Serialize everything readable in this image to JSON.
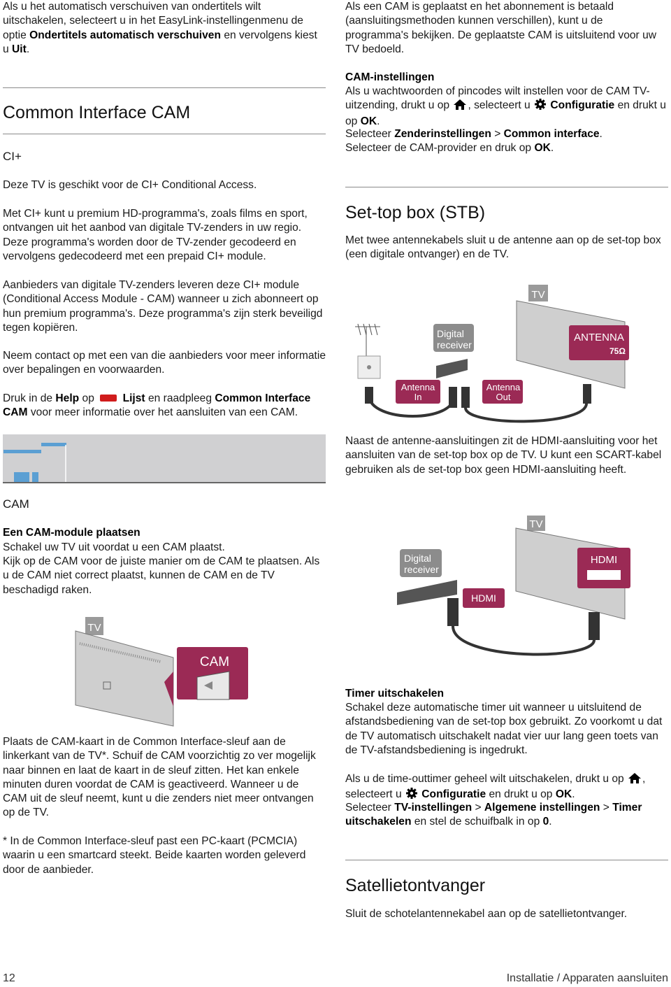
{
  "left": {
    "intro": [
      "Als u het automatisch verschuiven van ondertitels wilt uitschakelen, selecteert u in het EasyLink-instellingenmenu de optie ",
      {
        "b": "Ondertitels automatisch verschuiven"
      },
      " en vervolgens kiest u ",
      {
        "b": "Uit"
      },
      "."
    ],
    "heading": "Common Interface CAM",
    "ci_title": "CI+",
    "ci_p1": "Deze TV is geschikt voor de CI+ Conditional Access.",
    "ci_p2": "Met CI+ kunt u premium HD-programma's, zoals films en sport, ontvangen uit het aanbod van digitale TV-zenders in uw regio. Deze programma's worden door de TV-zender gecodeerd en vervolgens gedecodeerd met een prepaid CI+ module.",
    "ci_p3": "Aanbieders van digitale TV-zenders leveren deze CI+ module (Conditional Access Module - CAM) wanneer u zich abonneert op hun premium programma's. Deze programma's zijn sterk beveiligd tegen kopiëren.",
    "ci_p4": "Neem contact op met een van die aanbieders voor meer informatie over bepalingen en voorwaarden.",
    "ci_p5": [
      "Druk in de ",
      {
        "b": "Help"
      },
      " op ",
      {
        "icon": "red-button-icon"
      },
      " ",
      {
        "b": "Lijst"
      },
      " en raadpleeg ",
      {
        "b": "Common Interface CAM"
      },
      " voor meer informatie over het aansluiten van een CAM."
    ],
    "cam_title": "CAM",
    "cam_sub": "Een CAM-module plaatsen",
    "cam_p1": "Schakel uw TV uit voordat u een CAM plaatst.",
    "cam_p2": "Kijk op de CAM voor de juiste manier om de CAM te plaatsen. Als u de CAM niet correct plaatst, kunnen de CAM en de TV beschadigd raken.",
    "cam_img": {
      "tv_label": "TV",
      "cam_label": "CAM"
    },
    "cam_p3": "Plaats de CAM-kaart in de Common Interface-sleuf aan de linkerkant van de TV*. Schuif de CAM voorzichtig zo ver mogelijk naar binnen en laat de kaart in de sleuf zitten. Het kan enkele minuten duren voordat de CAM is geactiveerd. Wanneer u de CAM uit de sleuf neemt, kunt u die zenders niet meer ontvangen op de TV.",
    "cam_p4": "* In de Common Interface-sleuf past een PC-kaart (PCMCIA) waarin u een smartcard steekt. Beide kaarten worden geleverd door de aanbieder."
  },
  "right": {
    "intro": "Als een CAM is geplaatst en het abonnement is betaald (aansluitingsmethoden kunnen verschillen), kunt u de programma's bekijken. De geplaatste CAM is uitsluitend voor uw TV bedoeld.",
    "cam_settings_title": "CAM-instellingen",
    "cam_settings": [
      "Als u wachtwoorden of pincodes wilt instellen voor de CAM TV-uitzending, drukt u op ",
      {
        "icon": "home-icon"
      },
      ", selecteert u ",
      {
        "icon": "gear-icon"
      },
      " ",
      {
        "b": "Configuratie"
      },
      " en drukt u op ",
      {
        "b": "OK"
      },
      "."
    ],
    "cam_settings2": [
      "Selecteer ",
      {
        "b": "Zenderinstellingen"
      },
      " > ",
      {
        "b": "Common interface"
      },
      "."
    ],
    "cam_settings3": [
      "Selecteer de CAM-provider en druk op ",
      {
        "b": "OK"
      },
      "."
    ],
    "stb_heading": "Set-top box (STB)",
    "stb_p1": "Met twee antennekabels sluit u de antenne aan op de set-top box (een digitale ontvanger) en de TV.",
    "stb_img1": {
      "tv_label": "TV",
      "receiver_label_1": "Digital",
      "receiver_label_2": "receiver",
      "antenna_label": "ANTENNA",
      "ohm_label": "75Ω",
      "in_label_1": "Antenna",
      "in_label_2": "In",
      "out_label_1": "Antenna",
      "out_label_2": "Out"
    },
    "stb_p2": "Naast de antenne-aansluitingen zit de HDMI-aansluiting voor het aansluiten van de set-top box op de TV. U kunt een SCART-kabel gebruiken als de set-top box geen HDMI-aansluiting heeft.",
    "stb_img2": {
      "tv_label": "TV",
      "receiver_label_1": "Digital",
      "receiver_label_2": "receiver",
      "hdmi_tv_label": "HDMI",
      "hdmi_box_label": "HDMI"
    },
    "timer_title": "Timer uitschakelen",
    "timer_p1": "Schakel deze automatische timer uit wanneer u uitsluitend de afstandsbediening van de set-top box gebruikt. Zo voorkomt u dat de TV automatisch uitschakelt nadat vier uur lang geen toets van de TV-afstandsbediening is ingedrukt.",
    "timer_p2": [
      "Als u de time-outtimer geheel wilt uitschakelen, drukt u op ",
      {
        "icon": "home-icon"
      },
      ", selecteert u ",
      {
        "icon": "gear-icon"
      },
      " ",
      {
        "b": "Configuratie"
      },
      " en drukt u op ",
      {
        "b": "OK"
      },
      "."
    ],
    "timer_p3": [
      "Selecteer ",
      {
        "b": "TV-instellingen"
      },
      " > ",
      {
        "b": "Algemene instellingen"
      },
      " > ",
      {
        "b": "Timer uitschakelen"
      },
      " en stel de schuifbalk in op ",
      {
        "b": "0"
      },
      "."
    ],
    "sat_heading": "Satellietontvanger",
    "sat_p1": "Sluit de schotelantennekabel aan op de satellietontvanger."
  },
  "footer": {
    "page_number": "12",
    "section": "Installatie / Apparaten aansluiten"
  },
  "colors": {
    "label_magenta": "#9b2a55",
    "label_gray": "#8c8c8c",
    "red_button": "#d01c1c",
    "rule": "#8a8a8a"
  }
}
